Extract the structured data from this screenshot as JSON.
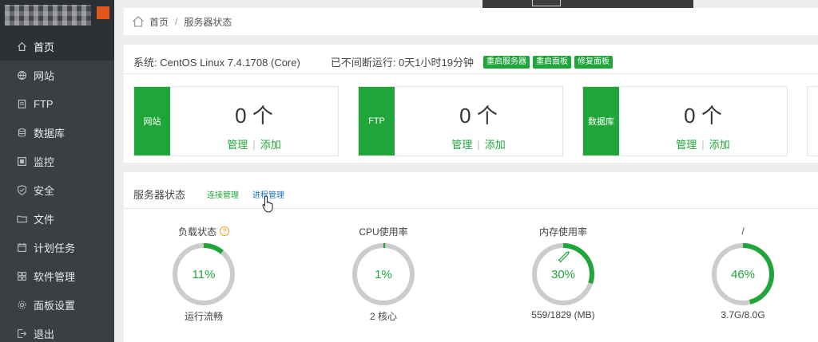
{
  "sidebar": {
    "items": [
      {
        "label": "首页",
        "icon": "home-icon"
      },
      {
        "label": "网站",
        "icon": "globe-icon"
      },
      {
        "label": "FTP",
        "icon": "ftp-icon"
      },
      {
        "label": "数据库",
        "icon": "database-icon"
      },
      {
        "label": "监控",
        "icon": "monitor-icon"
      },
      {
        "label": "安全",
        "icon": "shield-icon"
      },
      {
        "label": "文件",
        "icon": "folder-icon"
      },
      {
        "label": "计划任务",
        "icon": "calendar-icon"
      },
      {
        "label": "软件管理",
        "icon": "apps-icon"
      },
      {
        "label": "面板设置",
        "icon": "gear-icon"
      },
      {
        "label": "退出",
        "icon": "logout-icon"
      }
    ]
  },
  "breadcrumb": {
    "home": "首页",
    "separator": "/",
    "current": "服务器状态"
  },
  "system": {
    "os": "系统: CentOS Linux 7.4.1708 (Core)",
    "uptime": "已不间断运行: 0天1小时19分钟",
    "buttons": [
      "重启服务器",
      "重启面板",
      "修复面板"
    ]
  },
  "cards": [
    {
      "tag": "网站",
      "count": "0 个",
      "manage": "管理",
      "add": "添加"
    },
    {
      "tag": "FTP",
      "count": "0 个",
      "manage": "管理",
      "add": "添加"
    },
    {
      "tag": "数据库",
      "count": "0 个",
      "manage": "管理",
      "add": "添加"
    }
  ],
  "status": {
    "title": "服务器状态",
    "tabs": [
      "连接管理",
      "进程管理"
    ],
    "help": "?",
    "gauges": [
      {
        "label": "负载状态",
        "value": "11%",
        "percent": 11,
        "sub": "运行流畅"
      },
      {
        "label": "CPU使用率",
        "value": "1%",
        "percent": 1,
        "sub": "2 核心"
      },
      {
        "label": "内存使用率",
        "value": "30%",
        "percent": 30,
        "sub": "559/1829 (MB)"
      },
      {
        "label": "/",
        "value": "46%",
        "percent": 46,
        "sub": "3.7G/8.0G"
      }
    ]
  },
  "colors": {
    "accent": "#20a53a",
    "sidebar": "#3a3f44",
    "ring_track": "#cccccc"
  }
}
